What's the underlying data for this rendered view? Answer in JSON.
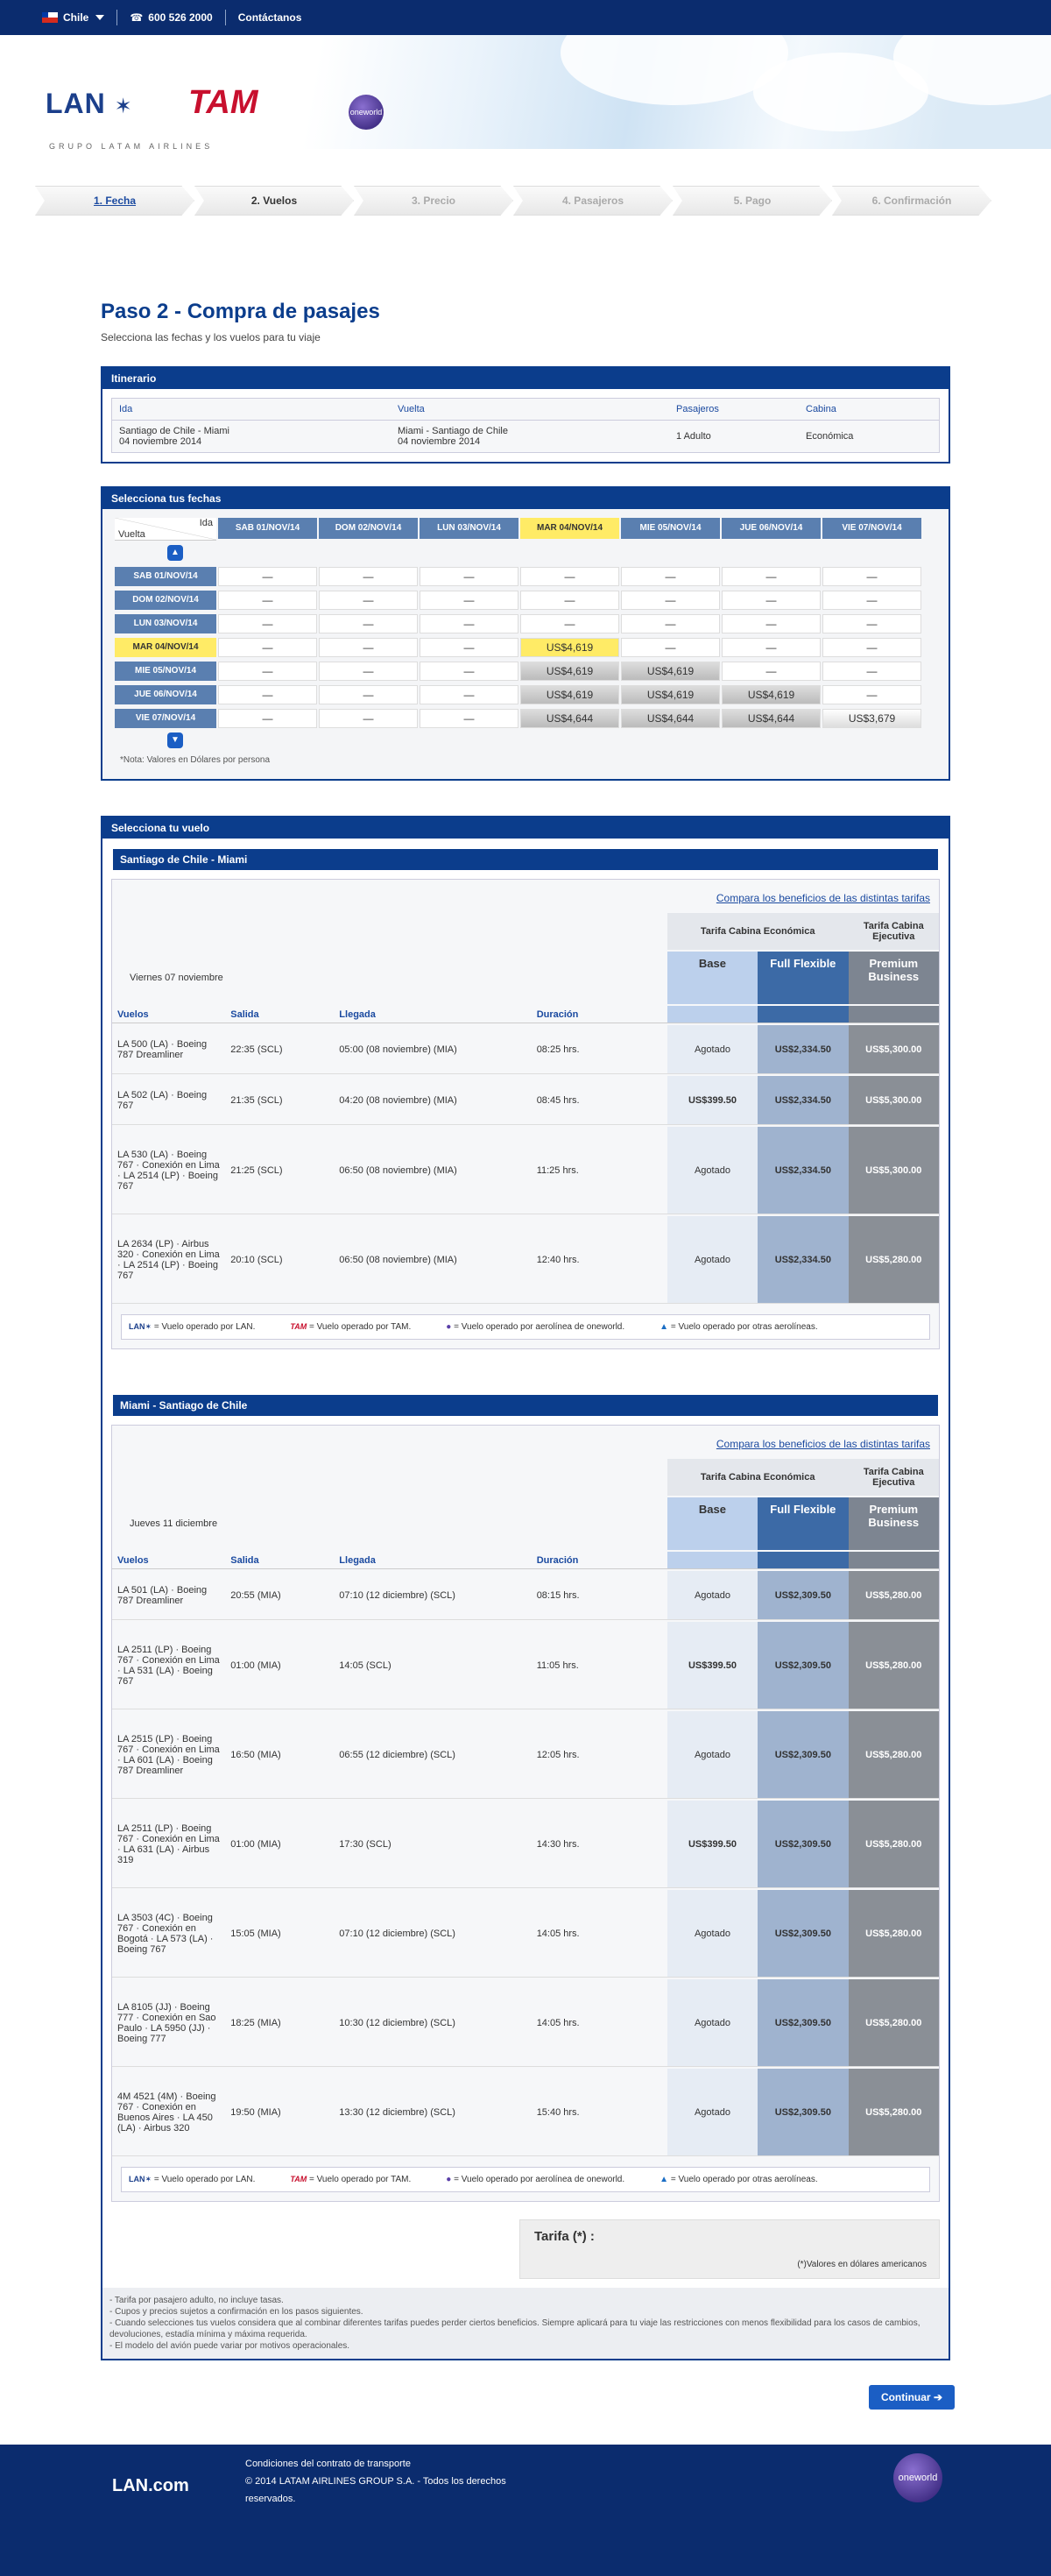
{
  "topbar": {
    "country": "Chile",
    "phone": "600 526 2000",
    "contact": "Contáctanos"
  },
  "header": {
    "logo_lan": "LAN",
    "logo_tam": "TAM",
    "logo_grupo": "GRUPO LATAM AIRLINES",
    "oneworld": "oneworld"
  },
  "steps": [
    "1. Fecha",
    "2. Vuelos",
    "3. Precio",
    "4. Pasajeros",
    "5. Pago",
    "6. Confirmación"
  ],
  "page": {
    "title": "Paso 2 - Compra de pasajes",
    "subtitle": "Selecciona las fechas y los vuelos para tu viaje"
  },
  "itinerario": {
    "title": "Itinerario",
    "headers": [
      "Ida",
      "Vuelta",
      "Pasajeros",
      "Cabina"
    ],
    "ida_route": "Santiago de Chile - Miami",
    "ida_date": "04 noviembre 2014",
    "vuelta_route": "Miami - Santiago de Chile",
    "vuelta_date": "04 noviembre 2014",
    "pasajeros": "1 Adulto",
    "cabina": "Económica"
  },
  "fechas": {
    "title": "Selecciona tus fechas",
    "ida": "Ida",
    "vuelta": "Vuelta",
    "cols": [
      "SAB 01/NOV/14",
      "DOM 02/NOV/14",
      "LUN 03/NOV/14",
      "MAR 04/NOV/14",
      "MIE 05/NOV/14",
      "JUE 06/NOV/14",
      "VIE 07/NOV/14"
    ],
    "rows": [
      "SAB 01/NOV/14",
      "DOM 02/NOV/14",
      "LUN 03/NOV/14",
      "MAR 04/NOV/14",
      "MIE 05/NOV/14",
      "JUE 06/NOV/14",
      "VIE 07/NOV/14"
    ],
    "dash": "—",
    "note": "*Nota: Valores en Dólares por persona"
  },
  "prices": {
    "p1": "US$4,619",
    "p2": "US$4,644",
    "p3": "US$3,679"
  },
  "vuelo": {
    "title": "Selecciona tu vuelo",
    "compare": "Compara los beneficios de las distintas tarifas",
    "cab_eco": "Tarifa Cabina Económica",
    "cab_eje": "Tarifa Cabina Ejecutiva",
    "base": "Base",
    "full": "Full Flexible",
    "premium": "Premium Business",
    "col_vuelos": "Vuelos",
    "col_salida": "Salida",
    "col_llegada": "Llegada",
    "col_duracion": "Duración"
  },
  "legend": {
    "lan": "= Vuelo operado por LAN.",
    "tam": "= Vuelo operado por TAM.",
    "ow": "= Vuelo operado por aerolínea de oneworld.",
    "otras": "= Vuelo operado por otras aerolíneas."
  },
  "outbound": {
    "route": "Santiago de Chile - Miami",
    "date": "Viernes 07 noviembre",
    "flights": [
      {
        "f": "LA 500 (LA) · Boeing 787 Dreamliner",
        "s": "22:35 (SCL)",
        "l": "05:00 (08 noviembre) (MIA)",
        "d": "08:25 hrs.",
        "b": "Agotado",
        "ff": "US$2,334.50",
        "p": "US$5,300.00"
      },
      {
        "f": "LA 502 (LA) · Boeing 767",
        "s": "21:35 (SCL)",
        "l": "04:20 (08 noviembre) (MIA)",
        "d": "08:45 hrs.",
        "b": "US$399.50",
        "ff": "US$2,334.50",
        "p": "US$5,300.00"
      },
      {
        "f": "LA 530 (LA) · Boeing 767 · Conexión en Lima · LA 2514 (LP) · Boeing 767",
        "s": "21:25 (SCL)",
        "l": "06:50 (08 noviembre) (MIA)",
        "d": "11:25 hrs.",
        "b": "Agotado",
        "ff": "US$2,334.50",
        "p": "US$5,300.00"
      },
      {
        "f": "LA 2634 (LP) · Airbus 320 · Conexión en Lima · LA 2514 (LP) · Boeing 767",
        "s": "20:10 (SCL)",
        "l": "06:50 (08 noviembre) (MIA)",
        "d": "12:40 hrs.",
        "b": "Agotado",
        "ff": "US$2,334.50",
        "p": "US$5,280.00"
      }
    ]
  },
  "inbound": {
    "route": "Miami - Santiago de Chile",
    "date": "Jueves 11 diciembre",
    "flights": [
      {
        "f": "LA 501 (LA) · Boeing 787 Dreamliner",
        "s": "20:55 (MIA)",
        "l": "07:10 (12 diciembre) (SCL)",
        "d": "08:15 hrs.",
        "b": "Agotado",
        "ff": "US$2,309.50",
        "p": "US$5,280.00"
      },
      {
        "f": "LA 2511 (LP) · Boeing 767 · Conexión en Lima · LA 531 (LA) · Boeing 767",
        "s": "01:00 (MIA)",
        "l": "14:05 (SCL)",
        "d": "11:05 hrs.",
        "b": "US$399.50",
        "ff": "US$2,309.50",
        "p": "US$5,280.00"
      },
      {
        "f": "LA 2515 (LP) · Boeing 767 · Conexión en Lima · LA 601 (LA) · Boeing 787 Dreamliner",
        "s": "16:50 (MIA)",
        "l": "06:55 (12 diciembre) (SCL)",
        "d": "12:05 hrs.",
        "b": "Agotado",
        "ff": "US$2,309.50",
        "p": "US$5,280.00"
      },
      {
        "f": "LA 2511 (LP) · Boeing 767 · Conexión en Lima · LA 631 (LA) · Airbus 319",
        "s": "01:00 (MIA)",
        "l": "17:30 (SCL)",
        "d": "14:30 hrs.",
        "b": "US$399.50",
        "ff": "US$2,309.50",
        "p": "US$5,280.00"
      },
      {
        "f": "LA 3503 (4C) · Boeing 767 · Conexión en Bogotá · LA 573 (LA) · Boeing 767",
        "s": "15:05 (MIA)",
        "l": "07:10 (12 diciembre) (SCL)",
        "d": "14:05 hrs.",
        "b": "Agotado",
        "ff": "US$2,309.50",
        "p": "US$5,280.00"
      },
      {
        "f": "LA 8105 (JJ) · Boeing 777 · Conexión en Sao Paulo · LA 5950 (JJ) · Boeing 777",
        "s": "18:25 (MIA)",
        "l": "10:30 (12 diciembre) (SCL)",
        "d": "14:05 hrs.",
        "b": "Agotado",
        "ff": "US$2,309.50",
        "p": "US$5,280.00"
      },
      {
        "f": "4M 4521 (4M) · Boeing 767 · Conexión en Buenos Aires · LA 450 (LA) · Airbus 320",
        "s": "19:50 (MIA)",
        "l": "13:30 (12 diciembre) (SCL)",
        "d": "15:40 hrs.",
        "b": "Agotado",
        "ff": "US$2,309.50",
        "p": "US$5,280.00"
      }
    ]
  },
  "tarifa": {
    "label": "Tarifa (*) :",
    "note": "(*)Valores en dólares americanos"
  },
  "fine": [
    "- Tarifa por pasajero adulto, no incluye tasas.",
    "- Cupos y precios sujetos a confirmación en los pasos siguientes.",
    "- Cuando selecciones tus vuelos considera que al combinar diferentes tarifas puedes perder ciertos beneficios. Siempre aplicará para tu viaje las restricciones con menos flexibilidad para los casos de cambios, devoluciones, estadía mínima y máxima requerida.",
    "- El modelo del avión puede variar por motivos operacionales."
  ],
  "continuar": "Continuar",
  "footer": {
    "logo": "LAN.com",
    "l1": "Condiciones del contrato de transporte",
    "l2": "© 2014 LATAM AIRLINES GROUP S.A. - Todos los derechos reservados.",
    "ow": "oneworld"
  }
}
